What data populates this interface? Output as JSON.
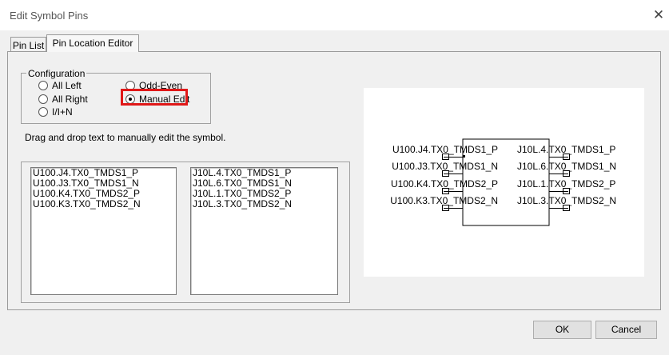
{
  "window": {
    "title": "Edit Symbol Pins",
    "close_glyph": "✕"
  },
  "tabs": [
    {
      "label": "Pin List"
    },
    {
      "label": "Pin Location Editor"
    }
  ],
  "configuration": {
    "label": "Configuration",
    "options": [
      {
        "label": "All Left",
        "selected": false
      },
      {
        "label": "All Right",
        "selected": false
      },
      {
        "label": "I/I+N",
        "selected": false
      },
      {
        "label": "Odd-Even",
        "selected": false
      },
      {
        "label": "Manual Edit",
        "selected": true
      }
    ]
  },
  "hint": "Drag and drop text to manually edit the symbol.",
  "left_list": [
    "U100.J4.TX0_TMDS1_P",
    "U100.J3.TX0_TMDS1_N",
    "U100.K4.TX0_TMDS2_P",
    "U100.K3.TX0_TMDS2_N"
  ],
  "right_list": [
    "J10L.4.TX0_TMDS1_P",
    "J10L.6.TX0_TMDS1_N",
    "J10L.1.TX0_TMDS2_P",
    "J10L.3.TX0_TMDS2_N"
  ],
  "symbol": {
    "left_pins": [
      "U100.J4.TX0_TMDS1_P",
      "U100.J3.TX0_TMDS1_N",
      "U100.K4.TX0_TMDS2_P",
      "U100.K3.TX0_TMDS2_N"
    ],
    "right_pins": [
      "J10L.4.TX0_TMDS1_P",
      "J10L.6.TX0_TMDS1_N",
      "J10L.1.TX0_TMDS2_P",
      "J10L.3.TX0_TMDS2_N"
    ]
  },
  "buttons": {
    "ok": "OK",
    "cancel": "Cancel"
  },
  "colors": {
    "highlight": "#e01818",
    "window_bg": "#f0f0f0"
  }
}
